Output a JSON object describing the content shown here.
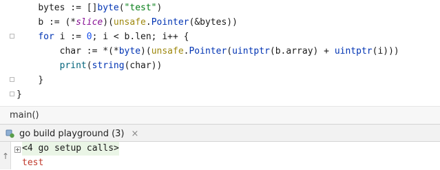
{
  "editor": {
    "lines": [
      {
        "indent": "    ",
        "tokens": [
          {
            "t": "bytes := []",
            "c": "op"
          },
          {
            "t": "byte",
            "c": "kw"
          },
          {
            "t": "(",
            "c": "op"
          },
          {
            "t": "\"test\"",
            "c": "str"
          },
          {
            "t": ")",
            "c": "op"
          }
        ]
      },
      {
        "indent": "    ",
        "tokens": [
          {
            "t": "b := (*",
            "c": "op"
          },
          {
            "t": "slice",
            "c": "type"
          },
          {
            "t": ")(",
            "c": "op"
          },
          {
            "t": "unsafe",
            "c": "pkg"
          },
          {
            "t": ".",
            "c": "op"
          },
          {
            "t": "Pointer",
            "c": "kw"
          },
          {
            "t": "(&bytes))",
            "c": "op"
          }
        ]
      },
      {
        "indent": "    ",
        "tokens": [
          {
            "t": "for",
            "c": "kw"
          },
          {
            "t": " i := ",
            "c": "op"
          },
          {
            "t": "0",
            "c": "num"
          },
          {
            "t": "; i < b.len; i++ {",
            "c": "op"
          }
        ]
      },
      {
        "indent": "        ",
        "tokens": [
          {
            "t": "char := *(*",
            "c": "op"
          },
          {
            "t": "byte",
            "c": "kw"
          },
          {
            "t": ")(",
            "c": "op"
          },
          {
            "t": "unsafe",
            "c": "pkg"
          },
          {
            "t": ".",
            "c": "op"
          },
          {
            "t": "Pointer",
            "c": "kw"
          },
          {
            "t": "(",
            "c": "op"
          },
          {
            "t": "uintptr",
            "c": "kw"
          },
          {
            "t": "(b.array) + ",
            "c": "op"
          },
          {
            "t": "uintptr",
            "c": "kw"
          },
          {
            "t": "(i)))",
            "c": "op"
          }
        ]
      },
      {
        "indent": "        ",
        "tokens": [
          {
            "t": "print",
            "c": "fn"
          },
          {
            "t": "(",
            "c": "op"
          },
          {
            "t": "string",
            "c": "kw"
          },
          {
            "t": "(char))",
            "c": "op"
          }
        ]
      },
      {
        "indent": "    ",
        "tokens": [
          {
            "t": "}",
            "c": "op"
          }
        ]
      },
      {
        "indent": "",
        "tokens": [
          {
            "t": "}",
            "c": "op"
          }
        ]
      }
    ]
  },
  "breadcrumb": {
    "text": "main()"
  },
  "run_panel": {
    "tab_label": "go build playground (3)",
    "close_glyph": "×",
    "icon": "run-config-icon"
  },
  "console": {
    "setup_calls": "<4 go setup calls>",
    "output": "test",
    "scroll_up_glyph": "↑"
  },
  "colors": {
    "keyword": "#0033b3",
    "string": "#067d17",
    "type": "#871094",
    "package": "#9e880d",
    "function": "#00627a",
    "number": "#1750eb",
    "output_text": "#c0392b"
  }
}
